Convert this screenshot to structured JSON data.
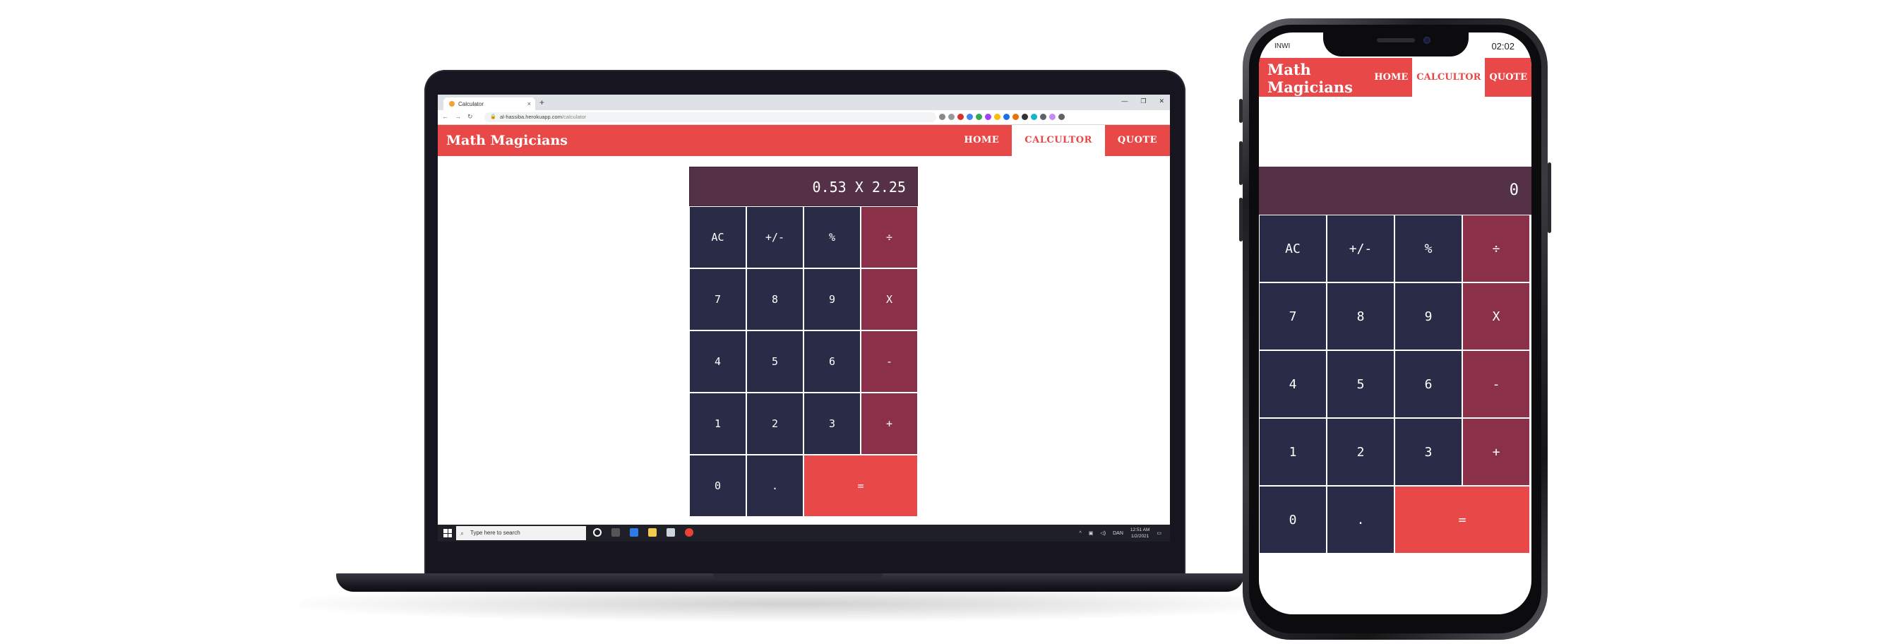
{
  "browser": {
    "tab_title": "Calculator",
    "url_host": "al-hassiba.herokuapp.com",
    "url_path": "/calculator",
    "new_tab": "+",
    "tab_close": "×"
  },
  "app": {
    "brand": "Math Magicians",
    "nav": [
      "HOME",
      "CALCULTOR",
      "QUOTE"
    ],
    "active_nav": "CALCULTOR"
  },
  "calculator_desktop": {
    "display": "0.53 X 2.25"
  },
  "calculator_mobile": {
    "display": "0"
  },
  "keys": {
    "row1": [
      "AC",
      "+/-",
      "%",
      "÷"
    ],
    "row2": [
      "7",
      "8",
      "9",
      "X"
    ],
    "row3": [
      "4",
      "5",
      "6",
      "-"
    ],
    "row4": [
      "1",
      "2",
      "3",
      "+"
    ],
    "row5": [
      "0",
      ".",
      "="
    ]
  },
  "taskbar": {
    "search_placeholder": "Type here to search",
    "lang": "DAN",
    "time": "12:51 AM",
    "date": "1/2/2021"
  },
  "phone_status": {
    "carrier": "INWI",
    "time": "02:02"
  },
  "colors": {
    "nav_red": "#e84848",
    "display_plum": "#543147",
    "key_navy": "#2a2b47",
    "operator_maroon": "#8a3149",
    "equals_red": "#e84848"
  }
}
